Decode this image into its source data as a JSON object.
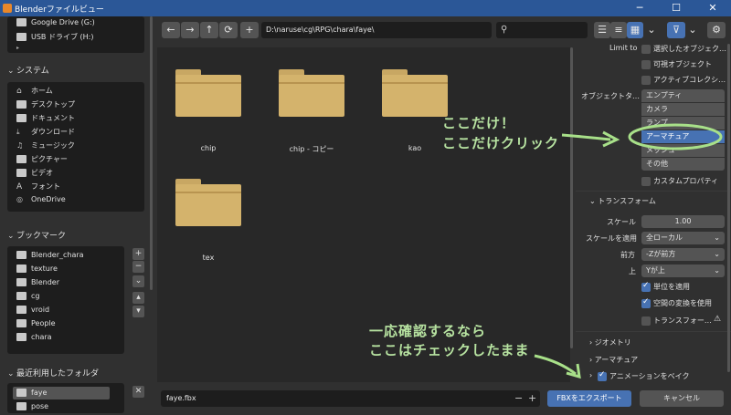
{
  "window": {
    "title": "Blenderファイルビュー",
    "controls": [
      "minimize-icon",
      "maximize-icon",
      "close-icon"
    ],
    "colors": {
      "titlebar": "#2b5797",
      "accent": "#4772b3",
      "folder": "#d4b36c",
      "annotation": "#b7e3a1"
    }
  },
  "sidebar": {
    "drives": [
      {
        "label": "Google Drive (G:)",
        "icon": "drive-icon"
      },
      {
        "label": "USB ドライブ (H:)",
        "icon": "usb-drive-icon"
      }
    ],
    "system": {
      "title": "システム",
      "items": [
        {
          "label": "ホーム",
          "icon": "home-icon"
        },
        {
          "label": "デスクトップ",
          "icon": "desktop-icon"
        },
        {
          "label": "ドキュメント",
          "icon": "documents-icon"
        },
        {
          "label": "ダウンロード",
          "icon": "download-icon"
        },
        {
          "label": "ミュージック",
          "icon": "music-icon"
        },
        {
          "label": "ピクチャー",
          "icon": "pictures-icon"
        },
        {
          "label": "ビデオ",
          "icon": "video-icon"
        },
        {
          "label": "フォント",
          "icon": "font-icon"
        },
        {
          "label": "OneDrive",
          "icon": "onedrive-icon"
        }
      ]
    },
    "bookmarks": {
      "title": "ブックマーク",
      "items": [
        {
          "label": "Blender_chara"
        },
        {
          "label": "texture"
        },
        {
          "label": "Blender"
        },
        {
          "label": "cg"
        },
        {
          "label": "vroid"
        },
        {
          "label": "People"
        },
        {
          "label": "chara"
        }
      ],
      "buttons": [
        "+",
        "−",
        "⌄",
        "▴",
        "▾"
      ]
    },
    "recent": {
      "title": "最近利用したフォルダ",
      "items": [
        {
          "label": "faye"
        },
        {
          "label": "pose"
        }
      ],
      "clear": "✕"
    }
  },
  "toolbar": {
    "nav": [
      "←",
      "→",
      "↑",
      "⟳"
    ],
    "new_folder": "+",
    "path": "D:\\naruse\\cg\\RPG\\chara\\faye\\",
    "search_value": ""
  },
  "files": [
    {
      "name": "chip"
    },
    {
      "name": "chip - コピー"
    },
    {
      "name": "kao"
    },
    {
      "name": "tex"
    }
  ],
  "options": {
    "limit_to_label": "Limit to",
    "limit_to": [
      {
        "label": "選択したオブジェク…",
        "checked": false
      },
      {
        "label": "可視オブジェクト",
        "checked": false
      },
      {
        "label": "アクティブコレクシ…",
        "checked": false
      }
    ],
    "object_type_label": "オブジェクトタ…",
    "object_types": [
      {
        "label": "エンプティ",
        "selected": false
      },
      {
        "label": "カメラ",
        "selected": false
      },
      {
        "label": "ランプ",
        "selected": false
      },
      {
        "label": "アーマチュア",
        "selected": true
      },
      {
        "label": "メッシュ",
        "selected": false
      },
      {
        "label": "その他",
        "selected": false
      }
    ],
    "custom_props": {
      "label": "カスタムプロパティ",
      "checked": false
    },
    "transform": {
      "title": "トランスフォーム",
      "scale_label": "スケール",
      "scale_value": "1.00",
      "apply_scale_label": "スケールを適用",
      "apply_scale_value": "全ローカル",
      "forward_label": "前方",
      "forward_value": "-Zが前方",
      "up_label": "上",
      "up_value": "Yが上",
      "apply_unit": {
        "label": "単位を適用",
        "checked": true
      },
      "space_transform": {
        "label": "空間の変換を使用",
        "checked": true
      },
      "transform_warn": {
        "label": "トランスフォー…",
        "checked": false
      }
    },
    "geometry": "ジオメトリ",
    "armature": "アーマチュア",
    "bake_anim": {
      "label": "アニメーションをベイク",
      "checked": true
    }
  },
  "bottom": {
    "filename": "faye.fbx",
    "minus": "−",
    "plus": "+",
    "export_label": "FBXをエクスポート",
    "cancel_label": "キャンセル"
  },
  "annotations": {
    "click_here_1": "ここだけ！",
    "click_here_2": "ここだけクリック",
    "confirm_1": "一応確認するなら",
    "confirm_2": "ここはチェックしたまま"
  }
}
